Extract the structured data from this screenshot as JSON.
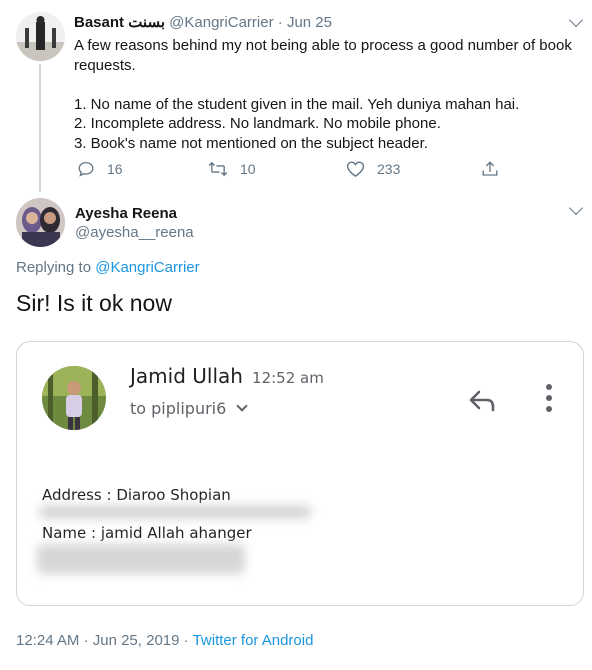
{
  "parent_tweet": {
    "name": "Basant بسنت",
    "handle": "@KangriCarrier",
    "separator": "·",
    "date": "Jun 25",
    "text_lines": [
      "A few reasons behind my not being able to process a good number of book",
      "requests.",
      "",
      "1. No name of the student given in the mail. Yeh duniya mahan hai.",
      "2. Incomplete address. No landmark. No mobile phone.",
      "3. Book's name not mentioned on the subject header."
    ],
    "replies": "16",
    "retweets": "10",
    "likes": "233"
  },
  "main_tweet": {
    "name": "Ayesha Reena",
    "handle": "@ayesha__reena",
    "replying_prefix": "Replying to",
    "replying_to": "@KangriCarrier",
    "text": "Sir! Is it ok now"
  },
  "email_card": {
    "sender": "Jamid Ullah",
    "time": "12:52 am",
    "to": "to piplipuri6",
    "address_line": "Address : Diaroo Shopian",
    "name_line": "Name : jamid Allah ahanger"
  },
  "footer": {
    "time": "12:24 AM",
    "separator": "·",
    "date": "Jun 25, 2019",
    "separator2": "·",
    "source": "Twitter for Android"
  },
  "colors": {
    "link": "#1b95e0",
    "secondary_text": "#657786",
    "primary_text": "#14171a",
    "border": "#ccd6dd"
  },
  "icons": [
    "chevron-down-icon",
    "reply-icon",
    "retweet-icon",
    "heart-icon",
    "share-icon",
    "gmail-reply-icon",
    "more-vert-icon"
  ]
}
